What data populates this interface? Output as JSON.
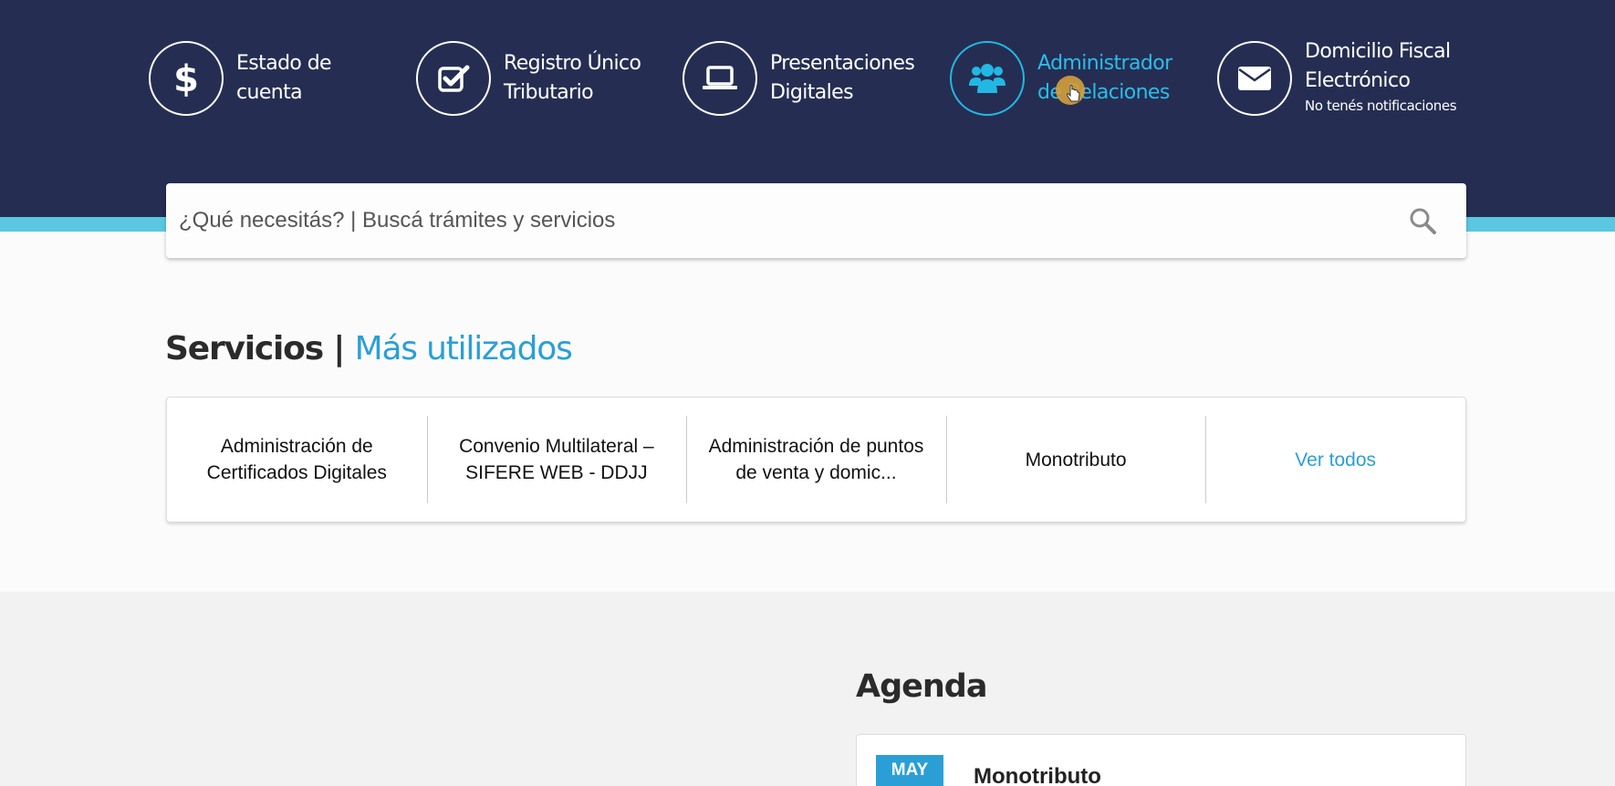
{
  "nav": {
    "items": [
      {
        "line1": "Estado de",
        "line2": "cuenta",
        "icon": "dollar-icon"
      },
      {
        "line1": "Registro Único",
        "line2": "Tributario",
        "icon": "check-square-icon"
      },
      {
        "line1": "Presentaciones",
        "line2": "Digitales",
        "icon": "laptop-icon"
      },
      {
        "line1": "Administrador",
        "line2": "de Relaciones",
        "icon": "users-icon",
        "active": true
      },
      {
        "line1": "Domicilio Fiscal",
        "line2": "Electrónico",
        "sub": "No tenés notificaciones",
        "icon": "envelope-icon"
      }
    ]
  },
  "search": {
    "placeholder": "¿Qué necesitás? | Buscá trámites y servicios",
    "icon": "search-icon"
  },
  "services": {
    "title": "Servicios |",
    "title_accent": "Más utilizados",
    "items": [
      "Administración de Certificados Digitales",
      "Convenio Multilateral – SIFERE WEB - DDJJ",
      "Administración de puntos de venta y domic...",
      "Monotributo"
    ],
    "see_all": "Ver todos"
  },
  "agenda": {
    "title": "Agenda",
    "month": "MAY",
    "event": "Monotributo"
  },
  "colors": {
    "header_bg": "#252e52",
    "accent_cyan": "#5bc7e1",
    "active_nav": "#2cbcea",
    "link_blue": "#2a9fd6"
  }
}
